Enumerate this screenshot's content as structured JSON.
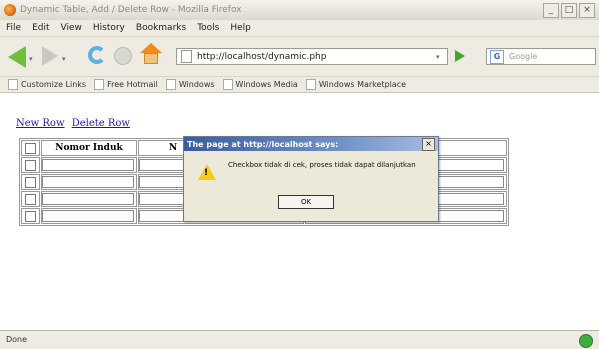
{
  "window": {
    "title": "Dynamic Table, Add / Delete Row - Mozilla Firefox",
    "controls": [
      "_",
      "□",
      "×"
    ]
  },
  "menu": [
    "File",
    "Edit",
    "View",
    "History",
    "Bookmarks",
    "Tools",
    "Help"
  ],
  "nav": {
    "url": "http://localhost/dynamic.php",
    "search_placeholder": "Google"
  },
  "bookmarks": [
    "Customize Links",
    "Free Hotmail",
    "Windows",
    "Windows Media",
    "Windows Marketplace"
  ],
  "page": {
    "new_row_link": "New Row",
    "delete_row_link": "Delete Row",
    "table": {
      "headers": [
        "",
        "Nomor Induk",
        "N",
        ""
      ],
      "row_count": 4
    }
  },
  "dialog": {
    "title": "The page at http://localhost says:",
    "message": "Checkbox tidak di cek, proses tidak dapat dilanjutkan",
    "ok_label": "OK"
  },
  "status": {
    "text": "Done"
  }
}
